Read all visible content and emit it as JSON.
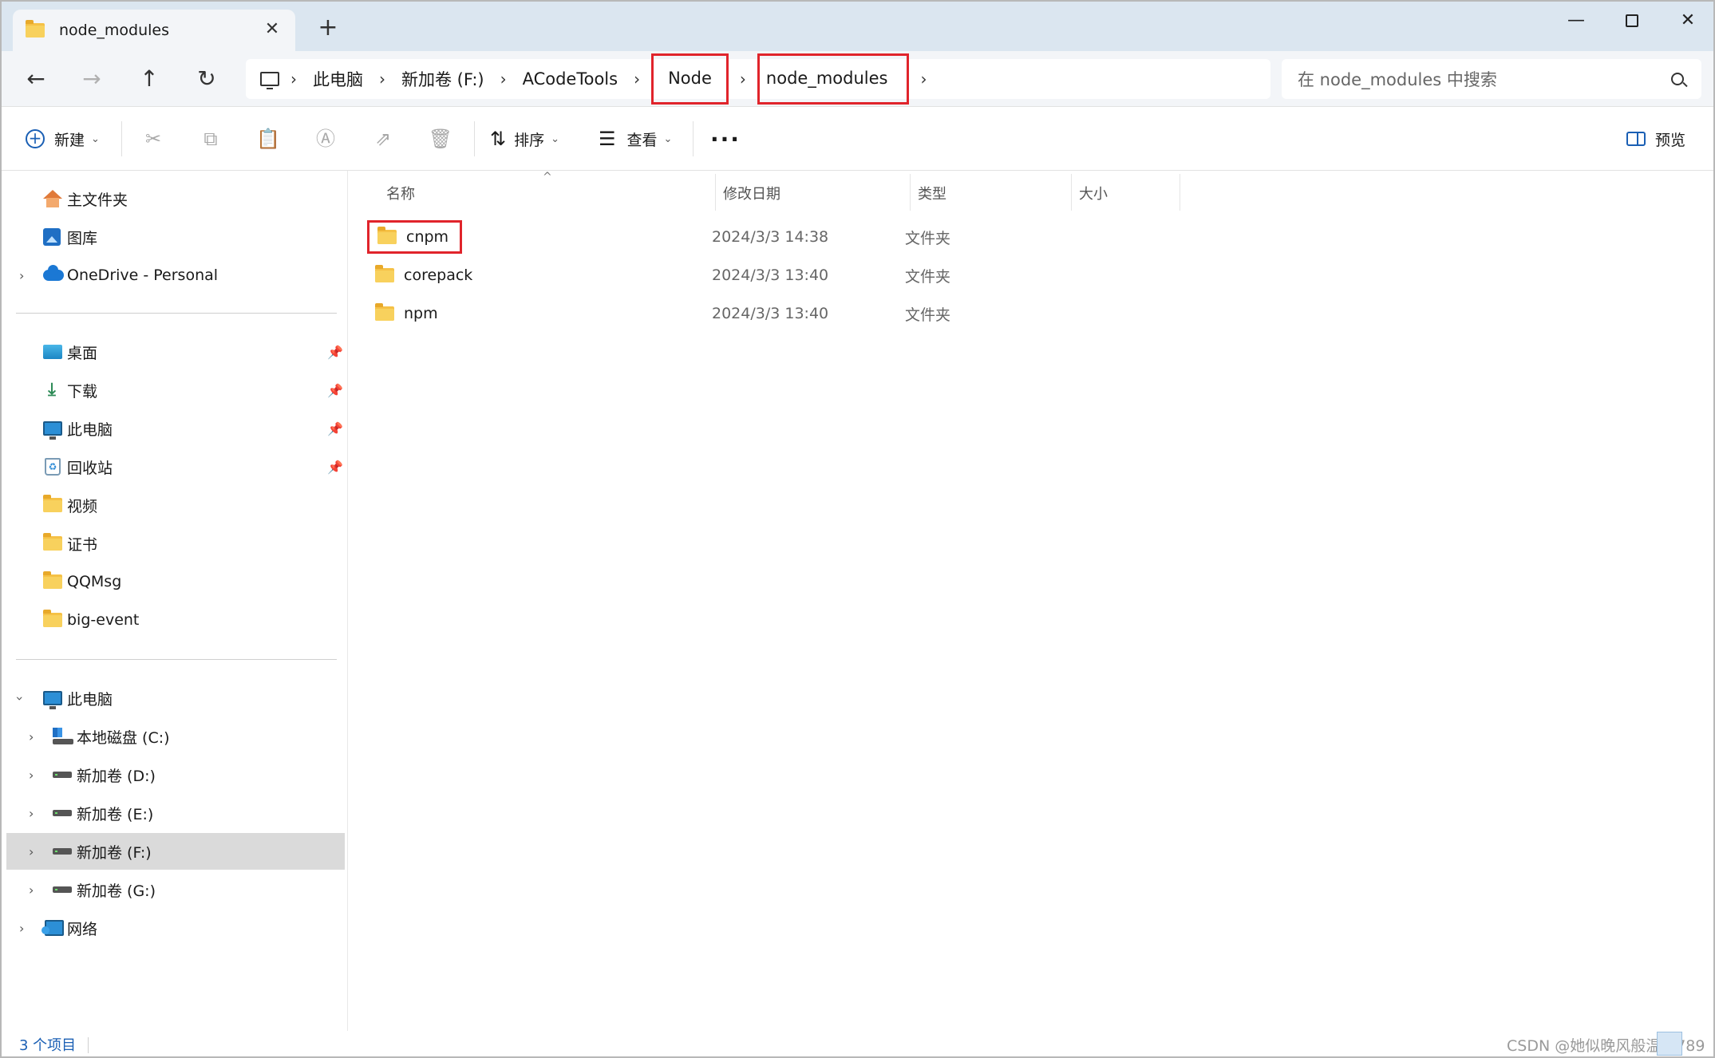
{
  "window": {
    "tab_title": "node_modules",
    "tab_close": "✕",
    "new_tab": "+",
    "minimize": "—",
    "close": "✕"
  },
  "address": {
    "crumbs": [
      "此电脑",
      "新加卷 (F:)",
      "ACodeTools",
      "Node",
      "node_modules"
    ],
    "highlighted": [
      "Node",
      "node_modules"
    ],
    "highlight_color": "#e0242b"
  },
  "search": {
    "placeholder": "在 node_modules 中搜索"
  },
  "toolbar": {
    "new_label": "新建",
    "sort_label": "排序",
    "view_label": "查看",
    "more_label": "···",
    "preview_label": "预览"
  },
  "sidebar": {
    "quick": [
      {
        "label": "主文件夹",
        "icon": "home-icon"
      },
      {
        "label": "图库",
        "icon": "gallery-icon"
      },
      {
        "label": "OneDrive - Personal",
        "icon": "onedrive-icon"
      }
    ],
    "pinned": [
      {
        "label": "桌面",
        "icon": "desktop-icon",
        "pinned": true
      },
      {
        "label": "下载",
        "icon": "download-icon",
        "pinned": true
      },
      {
        "label": "此电脑",
        "icon": "pc-icon",
        "pinned": true
      },
      {
        "label": "回收站",
        "icon": "recycle-bin-icon",
        "pinned": true
      },
      {
        "label": "视频",
        "icon": "folder-icon"
      },
      {
        "label": "证书",
        "icon": "folder-icon"
      },
      {
        "label": "QQMsg",
        "icon": "folder-icon"
      },
      {
        "label": "big-event",
        "icon": "folder-icon"
      }
    ],
    "this_pc_label": "此电脑",
    "drives": [
      {
        "label": "本地磁盘 (C:)",
        "icon": "system-drive-icon"
      },
      {
        "label": "新加卷 (D:)",
        "icon": "drive-icon"
      },
      {
        "label": "新加卷 (E:)",
        "icon": "drive-icon"
      },
      {
        "label": "新加卷 (F:)",
        "icon": "drive-icon",
        "selected": true
      },
      {
        "label": "新加卷 (G:)",
        "icon": "drive-icon"
      }
    ],
    "network_label": "网络"
  },
  "columns": {
    "name": "名称",
    "modified": "修改日期",
    "type": "类型",
    "size": "大小"
  },
  "files": [
    {
      "name": "cnpm",
      "modified": "2024/3/3 14:38",
      "type": "文件夹",
      "highlighted": true
    },
    {
      "name": "corepack",
      "modified": "2024/3/3 13:40",
      "type": "文件夹"
    },
    {
      "name": "npm",
      "modified": "2024/3/3 13:40",
      "type": "文件夹"
    }
  ],
  "status": {
    "item_count": "3 个项目",
    "watermark": "CSDN @她似晚风般温柔789"
  }
}
